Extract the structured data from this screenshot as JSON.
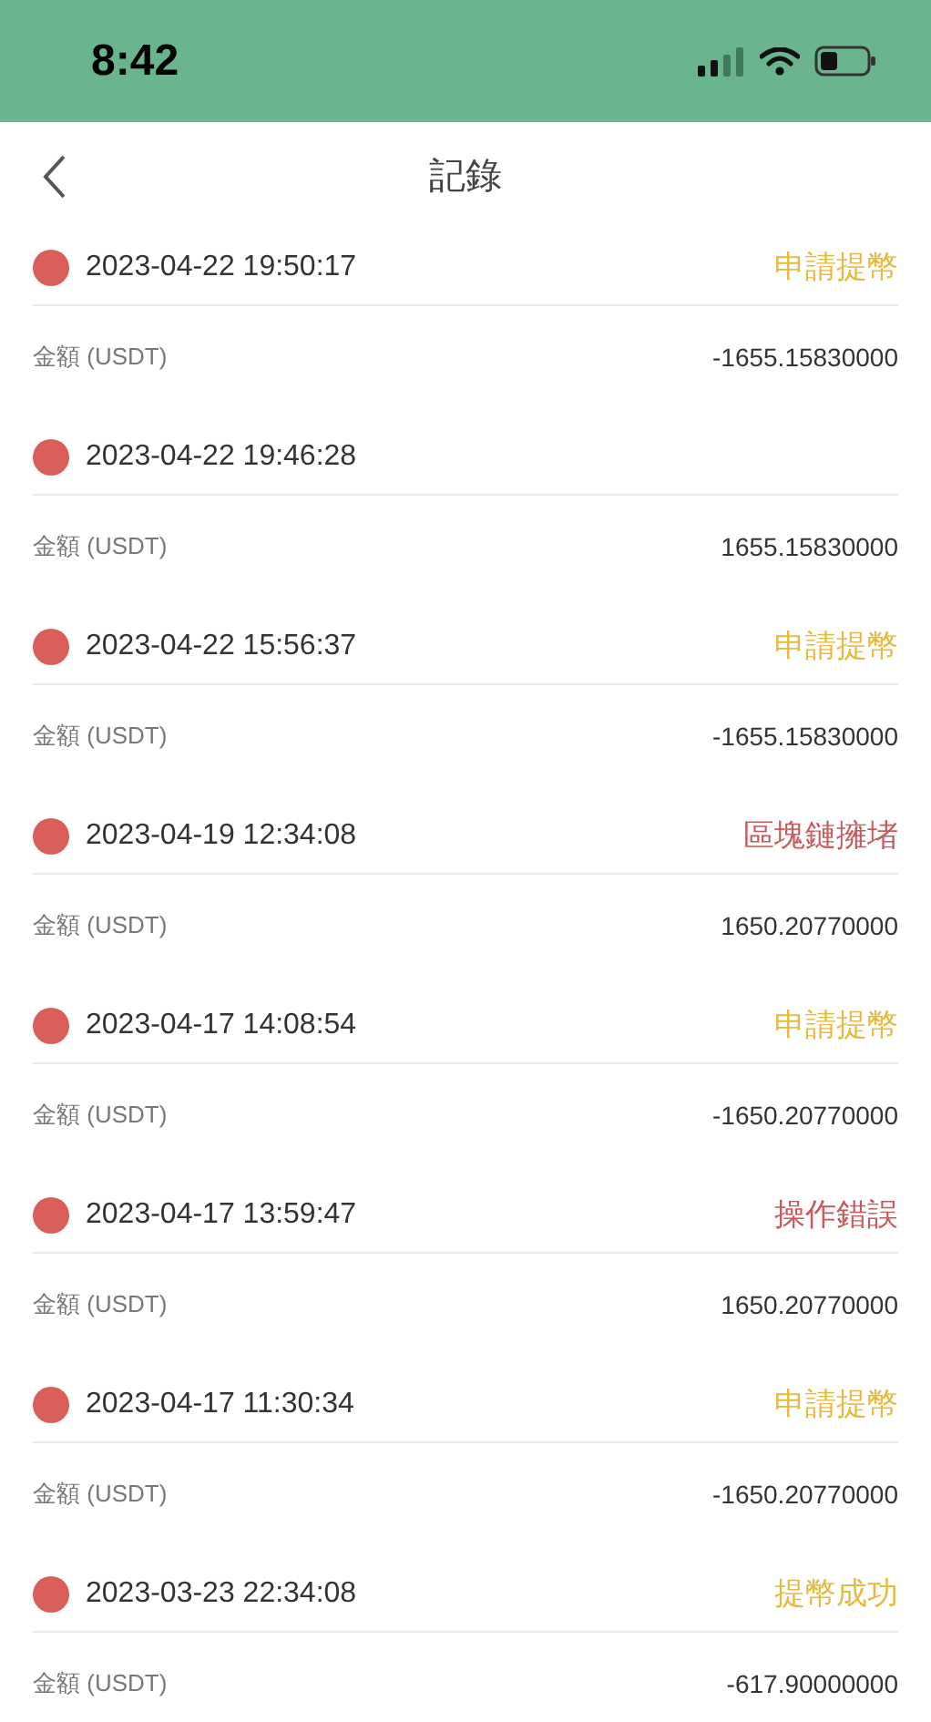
{
  "status_bar": {
    "time": "8:42"
  },
  "nav": {
    "title": "記錄"
  },
  "records": [
    {
      "time": "2023-04-22 19:50:17",
      "status": "申請提幣",
      "color": "#e6b93f",
      "amount_label": "金額 (USDT)",
      "amount": "-1655.15830000"
    },
    {
      "time": "2023-04-22 19:46:28",
      "amount_label": "金額 (USDT)",
      "amount": "1655.15830000"
    },
    {
      "time": "2023-04-22 15:56:37",
      "status": "申請提幣",
      "color": "#e6b93f",
      "amount_label": "金額 (USDT)",
      "amount": "-1655.15830000"
    },
    {
      "time": "2023-04-19 12:34:08",
      "status": "區塊鏈擁堵",
      "color": "#c9595b",
      "amount_label": "金額 (USDT)",
      "amount": "1650.20770000"
    },
    {
      "time": "2023-04-17 14:08:54",
      "status": "申請提幣",
      "color": "#e6b93f",
      "amount_label": "金額 (USDT)",
      "amount": "-1650.20770000"
    },
    {
      "time": "2023-04-17 13:59:47",
      "status": "操作錯誤",
      "color": "#c9595b",
      "amount_label": "金額 (USDT)",
      "amount": "1650.20770000"
    },
    {
      "time": "2023-04-17 11:30:34",
      "status": "申請提幣",
      "color": "#e6b93f",
      "amount_label": "金額 (USDT)",
      "amount": "-1650.20770000"
    },
    {
      "time": "2023-03-23 22:34:08",
      "status": "提幣成功",
      "color": "#e6b93f",
      "amount_label": "金額 (USDT)",
      "amount": "-617.90000000"
    }
  ]
}
